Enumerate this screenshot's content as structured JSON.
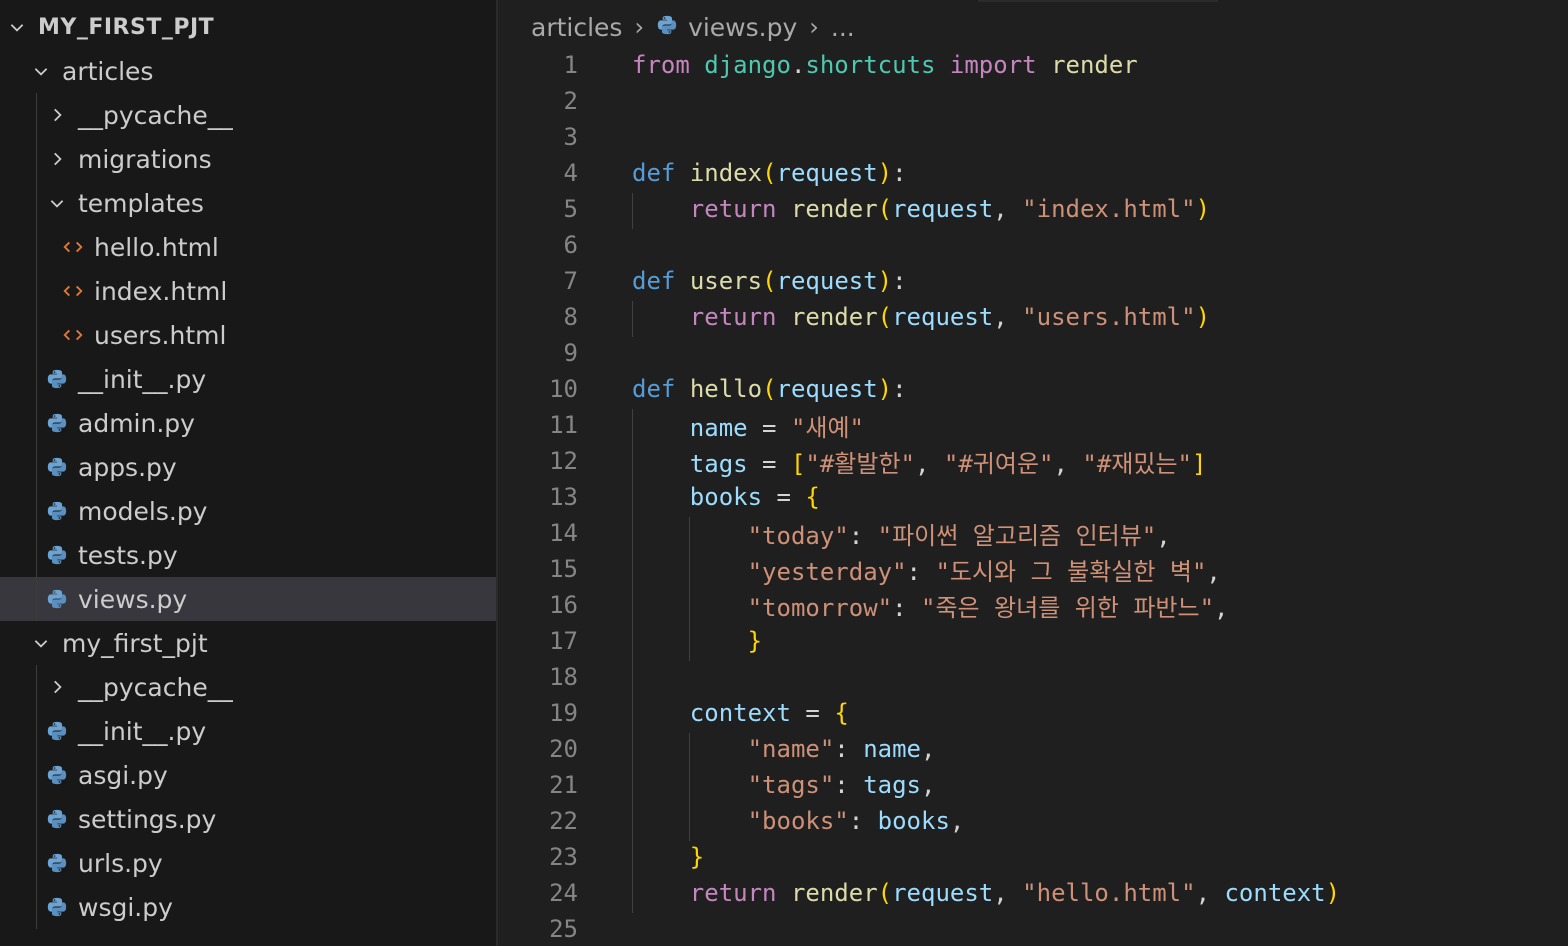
{
  "explorer": {
    "root": "MY_FIRST_PJT",
    "items": [
      {
        "label": "articles",
        "type": "folder",
        "open": true
      },
      {
        "label": "__pycache__",
        "type": "folder",
        "open": false
      },
      {
        "label": "migrations",
        "type": "folder",
        "open": false
      },
      {
        "label": "templates",
        "type": "folder",
        "open": true
      },
      {
        "label": "hello.html",
        "type": "html"
      },
      {
        "label": "index.html",
        "type": "html"
      },
      {
        "label": "users.html",
        "type": "html"
      },
      {
        "label": "__init__.py",
        "type": "python"
      },
      {
        "label": "admin.py",
        "type": "python"
      },
      {
        "label": "apps.py",
        "type": "python"
      },
      {
        "label": "models.py",
        "type": "python"
      },
      {
        "label": "tests.py",
        "type": "python"
      },
      {
        "label": "views.py",
        "type": "python",
        "selected": true
      },
      {
        "label": "my_first_pjt",
        "type": "folder",
        "open": true
      },
      {
        "label": "__pycache__",
        "type": "folder",
        "open": false
      },
      {
        "label": "__init__.py",
        "type": "python"
      },
      {
        "label": "asgi.py",
        "type": "python"
      },
      {
        "label": "settings.py",
        "type": "python"
      },
      {
        "label": "urls.py",
        "type": "python"
      },
      {
        "label": "wsgi.py",
        "type": "python"
      }
    ]
  },
  "breadcrumb": {
    "folder": "articles",
    "file": "views.py",
    "symbol": "..."
  },
  "colors": {
    "accent_selected_row": "#37373d",
    "python_icon": "#4b8bbe",
    "html_icon": "#e37933"
  },
  "code": {
    "lines": [
      "from django.shortcuts import render",
      "",
      "",
      "def index(request):",
      "    return render(request, \"index.html\")",
      "",
      "def users(request):",
      "    return render(request, \"users.html\")",
      "",
      "def hello(request):",
      "    name = \"새예\"",
      "    tags = [\"#활발한\", \"#귀여운\", \"#재밌는\"]",
      "    books = {",
      "        \"today\": \"파이썬 알고리즘 인터뷰\",",
      "        \"yesterday\": \"도시와 그 불확실한 벽\",",
      "        \"tomorrow\": \"죽은 왕녀를 위한 파반느\",",
      "        }",
      "",
      "    context = {",
      "        \"name\": name,",
      "        \"tags\": tags,",
      "        \"books\": books,",
      "    }",
      "    return render(request, \"hello.html\", context)",
      ""
    ]
  }
}
